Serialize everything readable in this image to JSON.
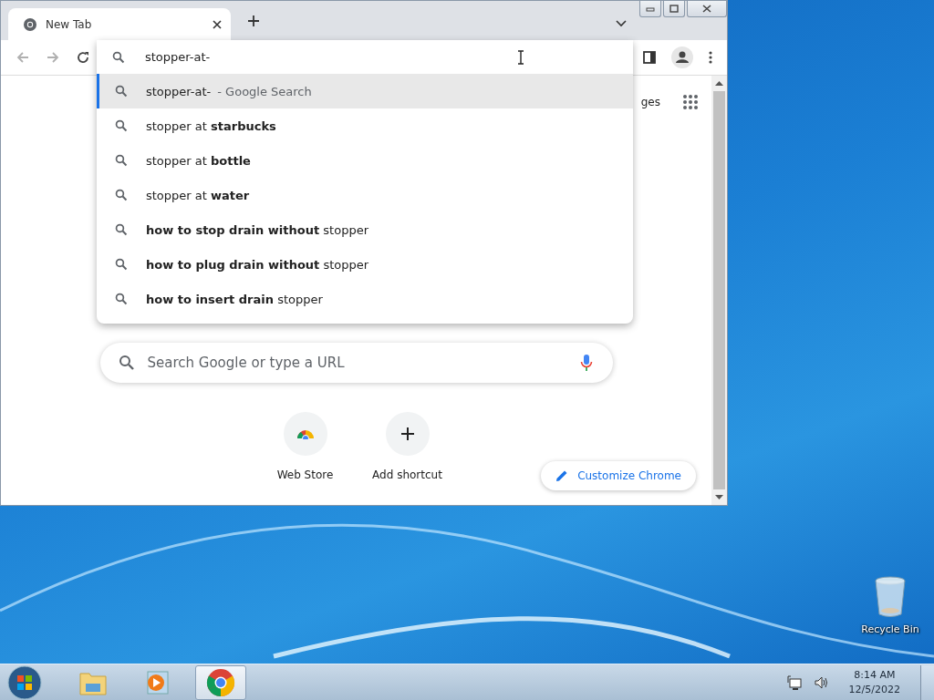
{
  "window": {
    "tab": {
      "title": "New Tab"
    },
    "omnibox": {
      "value": "stopper-at-"
    },
    "suggestions": [
      {
        "kind": "search",
        "text": "stopper-at-",
        "note": "- Google Search",
        "selected": true
      },
      {
        "kind": "suggestion",
        "text": "stopper at **starbucks**",
        "selected": false
      },
      {
        "kind": "suggestion",
        "text": "stopper at **bottle**",
        "selected": false
      },
      {
        "kind": "suggestion",
        "text": "stopper at **water**",
        "selected": false
      },
      {
        "kind": "suggestion",
        "text": "**how to stop drain without** stopper",
        "selected": false
      },
      {
        "kind": "suggestion",
        "text": "**how to plug drain without** stopper",
        "selected": false
      },
      {
        "kind": "suggestion",
        "text": "**how to insert drain** stopper",
        "selected": false
      }
    ],
    "partial_link": "ges",
    "search": {
      "placeholder": "Search Google or type a URL"
    },
    "shortcuts": [
      {
        "kind": "store",
        "label": "Web Store"
      },
      {
        "kind": "add",
        "label": "Add shortcut"
      }
    ],
    "customize_button": "Customize Chrome"
  },
  "desktop": {
    "icons": [
      {
        "label": "Recycle Bin"
      }
    ]
  },
  "taskbar": {
    "apps": [
      {
        "kind": "explorer",
        "selected": false
      },
      {
        "kind": "media",
        "selected": false
      },
      {
        "kind": "chrome",
        "selected": true
      }
    ],
    "clock": {
      "time": "8:14 AM",
      "date": "12/5/2022"
    }
  }
}
